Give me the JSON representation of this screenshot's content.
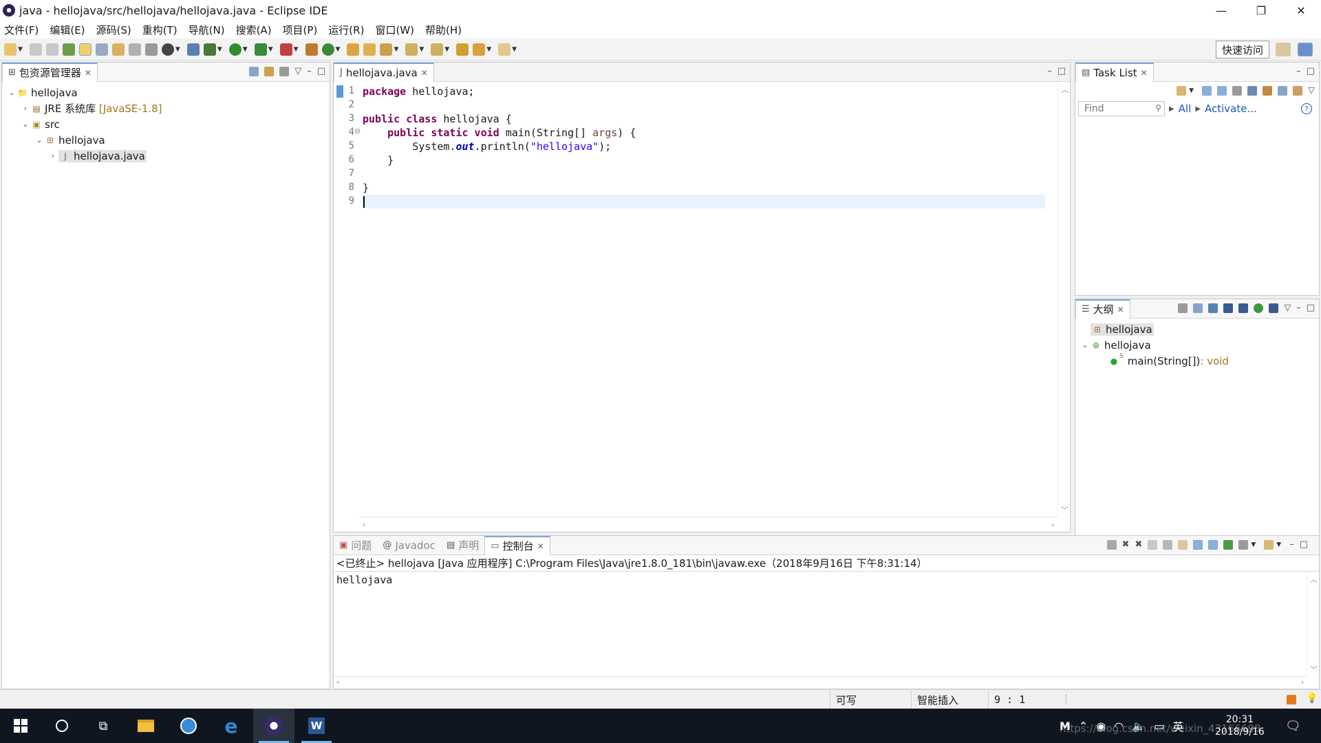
{
  "window": {
    "title": "java - hellojava/src/hellojava/hellojava.java - Eclipse IDE",
    "controls": {
      "minimize": "—",
      "restore": "❐",
      "close": "✕"
    }
  },
  "menu": [
    "文件(F)",
    "编辑(E)",
    "源码(S)",
    "重构(T)",
    "导航(N)",
    "搜索(A)",
    "项目(P)",
    "运行(R)",
    "窗口(W)",
    "帮助(H)"
  ],
  "toolbar": {
    "quick_access": "快速访问"
  },
  "package_explorer": {
    "tab": "包资源管理器",
    "tree": {
      "project": "hellojava",
      "jre_label": "JRE 系统库",
      "jre_decor": "[JavaSE-1.8]",
      "src": "src",
      "package": "hellojava",
      "file": "hellojava.java"
    }
  },
  "editor": {
    "tab": "hellojava.java",
    "line_numbers": [
      "1",
      "2",
      "3",
      "4",
      "5",
      "6",
      "7",
      "8",
      "9"
    ],
    "code": {
      "l1_kw": "package",
      "l1_rest": " hellojava;",
      "l3_kw": "public class",
      "l3_rest": " hellojava {",
      "l5_obj": "        System.",
      "l5_field": "out",
      "l5_mid": ".println(",
      "l5_str": "\"hellojava\"",
      "l5_end": ");",
      "l4_indent": "    ",
      "l4_kw": "public static void",
      "l4_mid": " main(String[] ",
      "l4_param": "args",
      "l4_end": ") {",
      "l6": "    }",
      "l8": "}"
    },
    "fold_marker": "⊖"
  },
  "task_list": {
    "tab": "Task List",
    "find_placeholder": "Find",
    "all_label": "All",
    "activate_label": "Activate..."
  },
  "outline": {
    "tab": "大纲",
    "items": {
      "package": "hellojava",
      "class": "hellojava",
      "method": "main(String[])",
      "method_type": " : void",
      "static_mark": "S"
    }
  },
  "bottom_tabs": {
    "problems": "问题",
    "javadoc": "Javadoc",
    "declaration": "声明",
    "console": "控制台"
  },
  "console": {
    "header": "<已终止> hellojava [Java 应用程序] C:\\Program Files\\Java\\jre1.8.0_181\\bin\\javaw.exe（2018年9月16日 下午8:31:14）",
    "output": "hellojava"
  },
  "status": {
    "writable": "可写",
    "insert_mode": "智能插入",
    "position": "9 : 1"
  },
  "taskbar": {
    "time": "20:31",
    "date": "2018/9/16",
    "ime": "英",
    "watermark": "https://blog.csdn.net/weixin_43166698"
  },
  "colors": {
    "keyword": "#7f0055",
    "string": "#2a00ff",
    "field": "#0000c0",
    "accent": "#7aa7e0"
  }
}
